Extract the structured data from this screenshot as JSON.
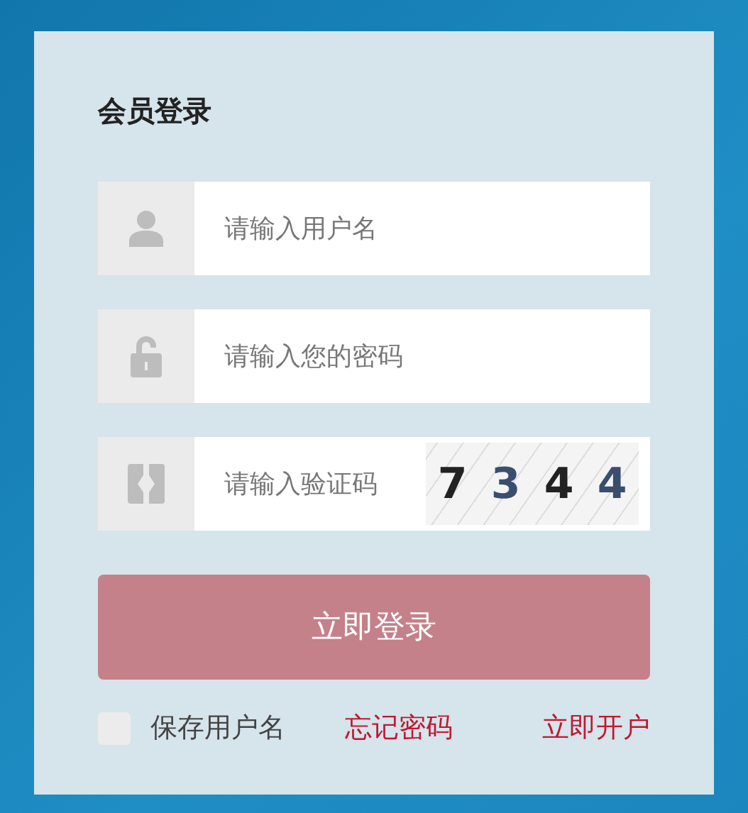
{
  "title": "会员登录",
  "fields": [
    {
      "kind": "user",
      "placeholder": "请输入用户名"
    },
    {
      "kind": "lock",
      "placeholder": "请输入您的密码"
    },
    {
      "kind": "code",
      "placeholder": "请输入验证码",
      "captcha": [
        "7",
        "3",
        "4",
        "4"
      ]
    }
  ],
  "submit": "立即登录",
  "remember": {
    "label": "保存用户名",
    "checked": false
  },
  "links": [
    "忘记密码",
    "立即开户"
  ]
}
